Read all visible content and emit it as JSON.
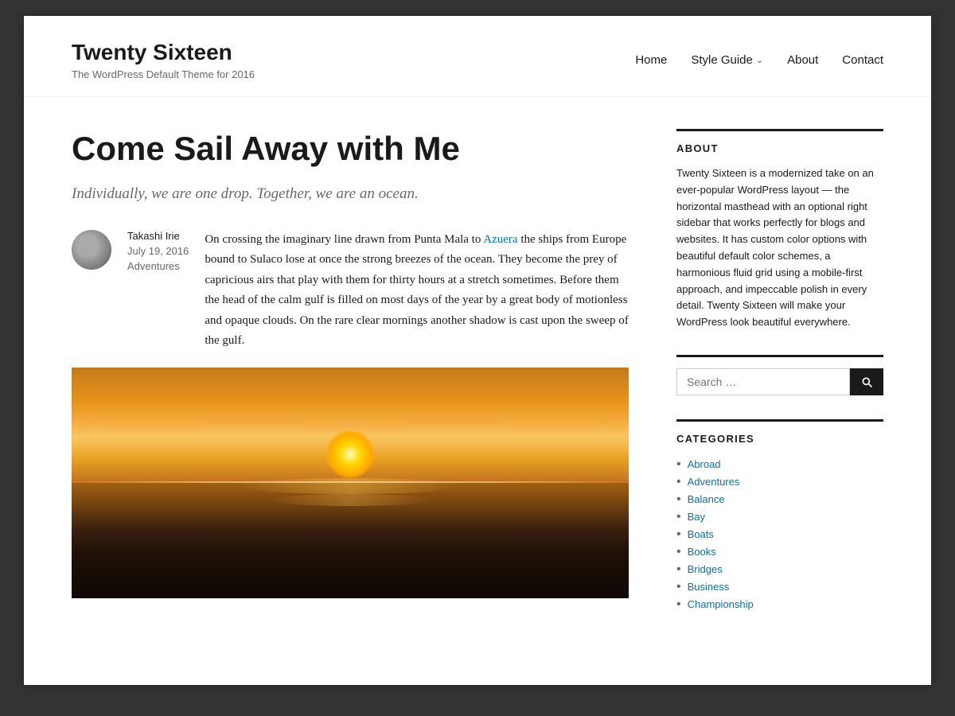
{
  "site": {
    "title": "Twenty Sixteen",
    "description": "The WordPress Default Theme for 2016"
  },
  "nav": {
    "items": [
      {
        "label": "Home",
        "has_arrow": false
      },
      {
        "label": "Style Guide",
        "has_arrow": true
      },
      {
        "label": "About",
        "has_arrow": false
      },
      {
        "label": "Contact",
        "has_arrow": false
      }
    ]
  },
  "post": {
    "title": "Come Sail Away with Me",
    "subtitle": "Individually, we are one drop. Together, we are an ocean.",
    "author": "Takashi Irie",
    "date": "July 19, 2016",
    "category": "Adventures",
    "body": "On crossing the imaginary line drawn from Punta Mala to Azuera the ships from Europe bound to Sulaco lose at once the strong breezes of the ocean. They become the prey of capricious airs that play with them for thirty hours at a stretch sometimes. Before them the head of the calm gulf is filled on most days of the year by a great body of motionless and opaque clouds. On the rare clear mornings another shadow is cast upon the sweep of the gulf.",
    "link_text": "Azuera",
    "link_pre": "On crossing the imaginary line drawn from Punta Mala to ",
    "link_post": " the ships from Europe bound to Sulaco lose at once the strong breezes of the ocean. They become the prey of capricious airs that play with them for thirty hours at a stretch sometimes. Before them the head of the calm gulf is filled on most days of the year by a great body of motionless and opaque clouds. On the rare clear mornings another shadow is cast upon the sweep of the gulf."
  },
  "sidebar": {
    "about_heading": "ABOUT",
    "about_text": "Twenty Sixteen is a modernized take on an ever-popular WordPress layout — the horizontal masthead with an optional right sidebar that works perfectly for blogs and websites. It has custom color options with beautiful default color schemes, a harmonious fluid grid using a mobile-first approach, and impeccable polish in every detail. Twenty Sixteen will make your WordPress look beautiful everywhere.",
    "search_placeholder": "Search …",
    "categories_heading": "CATEGORIES",
    "categories": [
      "Abroad",
      "Adventures",
      "Balance",
      "Bay",
      "Boats",
      "Books",
      "Bridges",
      "Business",
      "Championship"
    ]
  }
}
